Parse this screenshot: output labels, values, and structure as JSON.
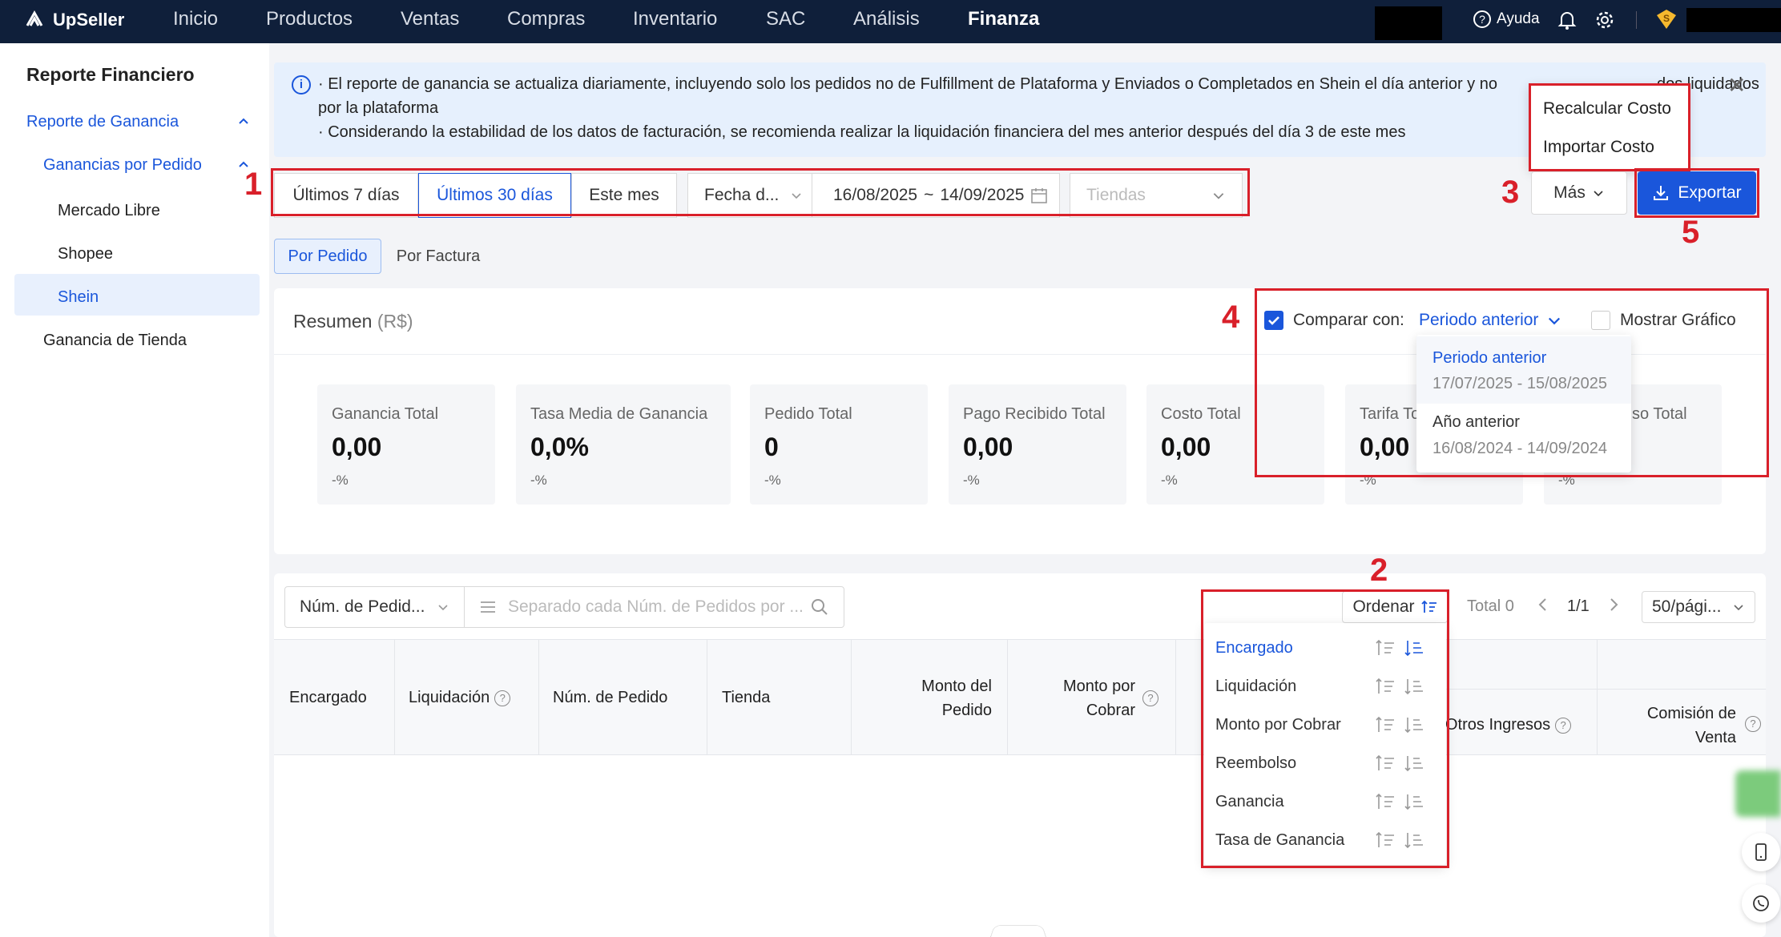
{
  "app": {
    "name": "UpSeller"
  },
  "nav": [
    "Inicio",
    "Productos",
    "Ventas",
    "Compras",
    "Inventario",
    "SAC",
    "Análisis",
    "Finanza"
  ],
  "nav_active": "Finanza",
  "header": {
    "help": "Ayuda"
  },
  "sidebar": {
    "title": "Reporte Financiero",
    "group": "Reporte de Ganancia",
    "subgroup": "Ganancias por Pedido",
    "items": [
      "Mercado Libre",
      "Shopee",
      "Shein"
    ],
    "selected": "Shein",
    "store_profit": "Ganancia de Tienda"
  },
  "notice": {
    "line1": "· El reporte de ganancia se actualiza diariamente, incluyendo solo los pedidos no de Fulfillment de Plataforma y Enviados o Completados en Shein el día anterior y no ",
    "line1_tail": "dos liquidados",
    "line2": "por la plataforma",
    "line3": "· Considerando la estabilidad de los datos de facturación, se recomienda realizar la liquidación financiera del mes anterior después del día 3 de este mes"
  },
  "more_menu": [
    "Recalcular Costo",
    "Importar Costo"
  ],
  "filters": {
    "last7": "Últimos 7 días",
    "last30": "Últimos 30 días",
    "this_month": "Este mes",
    "date_type": "Fecha d...",
    "date_from": "16/08/2025",
    "date_sep": "~",
    "date_to": "14/09/2025",
    "stores_placeholder": "Tiendas"
  },
  "actions": {
    "more": "Más",
    "export": "Exportar"
  },
  "markers": {
    "m1": "1",
    "m2": "2",
    "m3": "3",
    "m4": "4",
    "m5": "5"
  },
  "tabs": {
    "by_order": "Por Pedido",
    "by_invoice": "Por Factura"
  },
  "summary": {
    "title": "Resumen",
    "currency": "(R$)",
    "compare_label": "Comparar con:",
    "compare_value": "Periodo anterior",
    "show_chart": "Mostrar Gráfico",
    "compare_options": [
      {
        "label": "Periodo anterior",
        "range": "17/07/2025 - 15/08/2025"
      },
      {
        "label": "Año anterior",
        "range": "16/08/2024 - 14/09/2024"
      }
    ],
    "stats": [
      {
        "label": "Ganancia Total",
        "value": "0,00",
        "pct": "-%"
      },
      {
        "label": "Tasa Media de Ganancia",
        "value": "0,0%",
        "pct": "-%"
      },
      {
        "label": "Pedido Total",
        "value": "0",
        "pct": "-%"
      },
      {
        "label": "Pago Recibido Total",
        "value": "0,00",
        "pct": "-%"
      },
      {
        "label": "Costo Total",
        "value": "0,00",
        "pct": "-%"
      },
      {
        "label": "Tarifa To",
        "value": "0,00",
        "pct": "-%"
      },
      {
        "label": "so Total",
        "value": "",
        "pct": "-%"
      }
    ]
  },
  "table": {
    "search_field": "Núm. de Pedid...",
    "search_placeholder": "Separado cada Núm. de Pedidos por ...",
    "sort_label": "Ordenar",
    "total": "Total 0",
    "page": "1/1",
    "page_size": "50/pági...",
    "headers": {
      "encargado": "Encargado",
      "liquidacion": "Liquidación",
      "num_pedido": "Núm. de Pedido",
      "tienda": "Tienda",
      "monto_pedido_1": "Monto del",
      "monto_pedido_2": "Pedido",
      "monto_cobrar_1": "Monto por",
      "monto_cobrar_2": "Cobrar",
      "otros": "Otros Ingresos",
      "comision_1": "Comisión de",
      "comision_2": "Venta"
    },
    "sort_options": [
      "Encargado",
      "Liquidación",
      "Monto por Cobrar",
      "Reembolso",
      "Ganancia",
      "Tasa de Ganancia"
    ]
  },
  "colors": {
    "primary": "#1a56db",
    "annotation": "#d9202a",
    "topbar": "#0f1f3a"
  }
}
